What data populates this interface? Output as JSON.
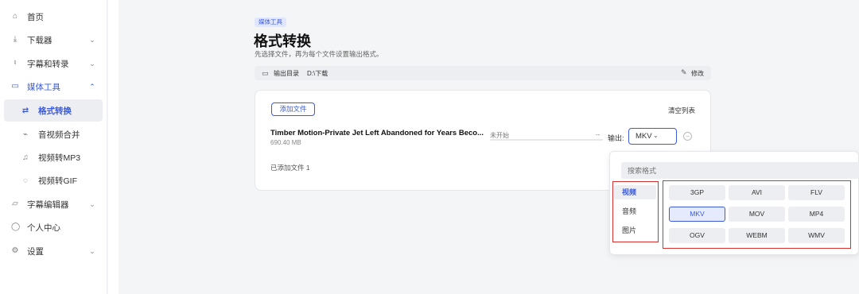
{
  "sidebar": {
    "items": [
      {
        "label": "首页",
        "icon": "home-icon"
      },
      {
        "label": "下载器",
        "icon": "download-icon"
      },
      {
        "label": "字幕和转录",
        "icon": "microphone-icon"
      },
      {
        "label": "媒体工具",
        "icon": "video-icon"
      },
      {
        "label": "字幕编辑器",
        "icon": "subtitle-icon"
      },
      {
        "label": "个人中心",
        "icon": "user-icon"
      },
      {
        "label": "设置",
        "icon": "gear-icon"
      }
    ],
    "media_sub": [
      {
        "label": "格式转换",
        "icon": "swap-icon"
      },
      {
        "label": "音视频合并",
        "icon": "link-icon"
      },
      {
        "label": "视频转MP3",
        "icon": "music-icon"
      },
      {
        "label": "视频转GIF",
        "icon": "bulb-icon"
      }
    ]
  },
  "header": {
    "badge": "媒体工具",
    "title": "格式转换",
    "subtitle": "先选择文件，再为每个文件设置输出格式。"
  },
  "output_dir": {
    "label": "输出目录",
    "path": "D:\\下载",
    "edit_label": "修改"
  },
  "card": {
    "add_button": "添加文件",
    "clear_button": "清空列表",
    "file": {
      "name": "Timber Motion-Private Jet Left Abandoned for Years Beco...",
      "size": "690.40 MB",
      "status": "未开始",
      "dash": "--",
      "output_label": "输出:",
      "format": "MKV"
    },
    "count_text": "已添加文件 1"
  },
  "dropdown": {
    "search_placeholder": "搜索格式",
    "categories": [
      "视频",
      "音频",
      "图片"
    ],
    "active_category": "视频",
    "formats": [
      "3GP",
      "AVI",
      "FLV",
      "MKV",
      "MOV",
      "MP4",
      "OGV",
      "WEBM",
      "WMV"
    ],
    "selected_format": "MKV"
  },
  "colors": {
    "accent": "#3b5bdb",
    "highlight_border": "#d93030"
  }
}
